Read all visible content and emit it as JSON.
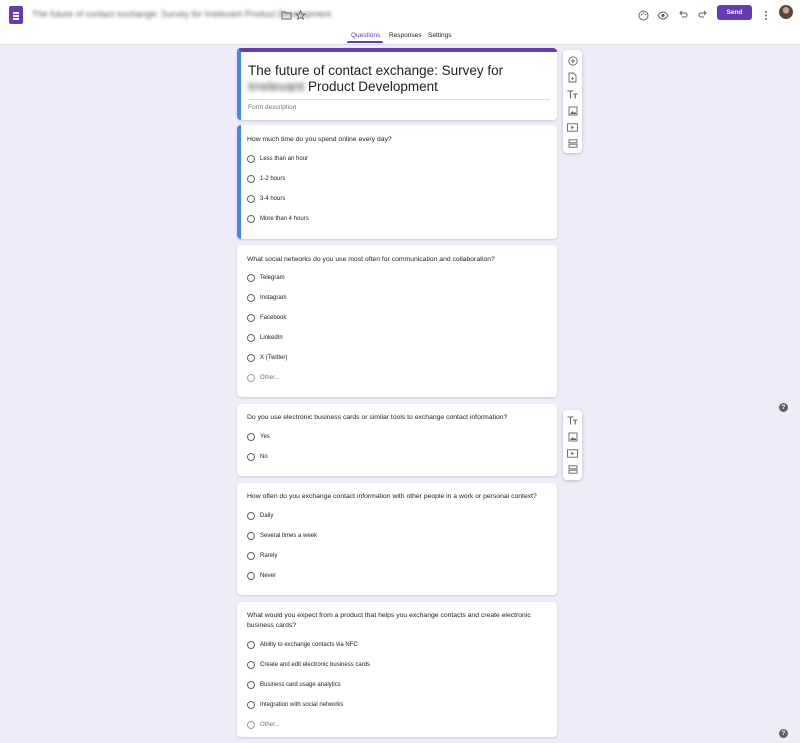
{
  "header": {
    "doc_title": "The future of contact exchange: Survey for Irrelevant Product Development",
    "send_label": "Send"
  },
  "tabs": [
    {
      "label": "Questions"
    },
    {
      "label": "Responses"
    },
    {
      "label": "Settings"
    }
  ],
  "form": {
    "title_line1": "The future of contact exchange: Survey for",
    "title_blurred": "Irrelevant",
    "title_line2_rest": " Product Development",
    "description_placeholder": "Form description"
  },
  "questions": [
    {
      "title": "How much time do you spend online every day?",
      "options": [
        "Less than an hour",
        "1-2 hours",
        "3-4 hours",
        "More than 4 hours"
      ]
    },
    {
      "title": "What social networks do you use most often for communication and collaboration?",
      "options": [
        "Telegram",
        "Instagram",
        "Facebook",
        "LinkedIn",
        "X (Twitter)"
      ],
      "other": "Other..."
    },
    {
      "title": "Do you use electronic business cards or similar tools to exchange contact information?",
      "options": [
        "Yes",
        "No"
      ]
    },
    {
      "title": "How often do you exchange contact information with other people in a work or personal context?",
      "options": [
        "Daily",
        "Several times a week",
        "Rarely",
        "Never"
      ]
    },
    {
      "title": "What would you expect from a product that helps you exchange contacts and create electronic business cards?",
      "options": [
        "Ability to exchange contacts via NFC",
        "Create and edit electronic business cards",
        "Business card usage analytics",
        "Integration with social networks"
      ],
      "other": "Other..."
    }
  ],
  "help_label": "?",
  "colors": {
    "accent": "#673ab7",
    "selected_border": "#4285f4",
    "background": "#f0ebf8"
  }
}
